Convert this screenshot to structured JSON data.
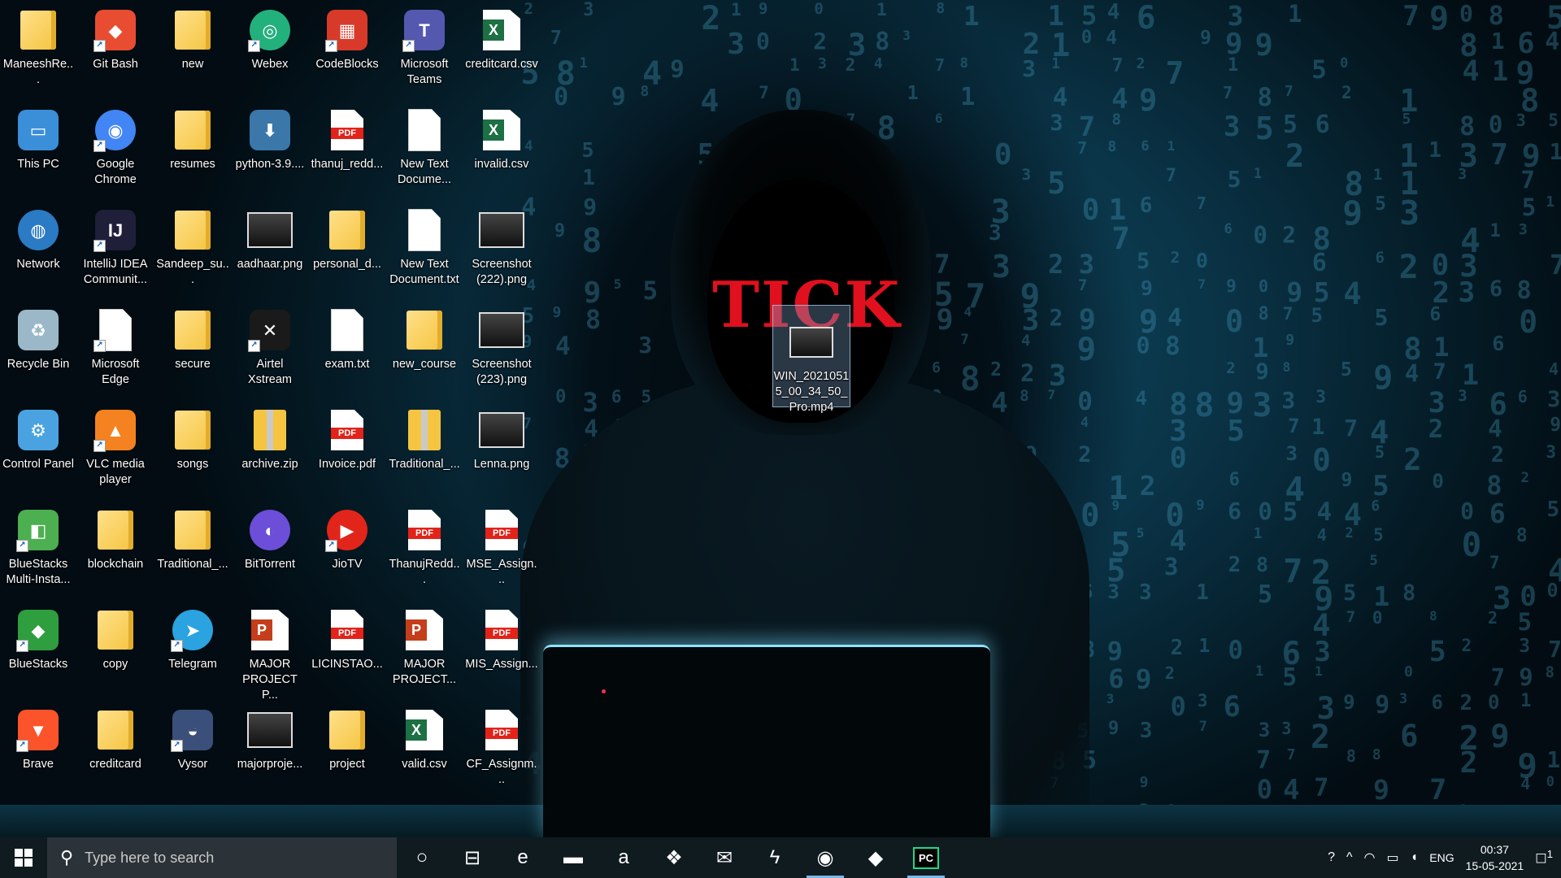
{
  "wallpaper": {
    "logo_text": "TICK"
  },
  "desktop_icons": [
    {
      "label": "ManeeshRe...",
      "icon": "user-folder-icon",
      "kind": "folder"
    },
    {
      "label": "This PC",
      "icon": "this-pc-icon",
      "kind": "app"
    },
    {
      "label": "Network",
      "icon": "network-icon",
      "kind": "app"
    },
    {
      "label": "Recycle Bin",
      "icon": "recycle-bin-icon",
      "kind": "app"
    },
    {
      "label": "Control Panel",
      "icon": "control-panel-icon",
      "kind": "app"
    },
    {
      "label": "BlueStacks Multi-Insta...",
      "icon": "bluestacks-multi-icon",
      "kind": "app"
    },
    {
      "label": "BlueStacks",
      "icon": "bluestacks-icon",
      "kind": "app"
    },
    {
      "label": "Brave",
      "icon": "brave-icon",
      "kind": "app"
    },
    {
      "label": "Git Bash",
      "icon": "git-bash-icon",
      "kind": "app"
    },
    {
      "label": "Google Chrome",
      "icon": "chrome-icon",
      "kind": "app"
    },
    {
      "label": "IntelliJ IDEA Communit...",
      "icon": "intellij-icon",
      "kind": "app"
    },
    {
      "label": "Microsoft Edge",
      "icon": "edge-shortcut-icon",
      "kind": "doc"
    },
    {
      "label": "VLC media player",
      "icon": "vlc-icon",
      "kind": "app"
    },
    {
      "label": "blockchain",
      "icon": "folder-icon",
      "kind": "folder"
    },
    {
      "label": "copy",
      "icon": "folder-icon",
      "kind": "folder"
    },
    {
      "label": "creditcard",
      "icon": "folder-icon",
      "kind": "folder"
    },
    {
      "label": "new",
      "icon": "folder-icon",
      "kind": "folder"
    },
    {
      "label": "resumes",
      "icon": "folder-icon",
      "kind": "folder"
    },
    {
      "label": "Sandeep_su...",
      "icon": "folder-icon",
      "kind": "folder"
    },
    {
      "label": "secure",
      "icon": "folder-icon",
      "kind": "folder"
    },
    {
      "label": "songs",
      "icon": "folder-icon",
      "kind": "folder"
    },
    {
      "label": "Traditional_...",
      "icon": "folder-icon",
      "kind": "folder"
    },
    {
      "label": "Telegram",
      "icon": "telegram-icon",
      "kind": "app"
    },
    {
      "label": "Vysor",
      "icon": "vysor-icon",
      "kind": "app"
    },
    {
      "label": "Webex",
      "icon": "webex-icon",
      "kind": "app"
    },
    {
      "label": "python-3.9....",
      "icon": "python-installer-icon",
      "kind": "app"
    },
    {
      "label": "aadhaar.png",
      "icon": "image-file-icon",
      "kind": "img"
    },
    {
      "label": "Airtel Xstream",
      "icon": "airtel-xstream-icon",
      "kind": "app"
    },
    {
      "label": "archive.zip",
      "icon": "zip-file-icon",
      "kind": "zip"
    },
    {
      "label": "BitTorrent",
      "icon": "bittorrent-icon",
      "kind": "app"
    },
    {
      "label": "MAJOR PROJECT P...",
      "icon": "powerpoint-file-icon",
      "kind": "ppt"
    },
    {
      "label": "majorproje...",
      "icon": "presentation-image-icon",
      "kind": "img"
    },
    {
      "label": "CodeBlocks",
      "icon": "codeblocks-icon",
      "kind": "app"
    },
    {
      "label": "thanuj_redd...",
      "icon": "pdf-file-icon",
      "kind": "pdf"
    },
    {
      "label": "personal_d...",
      "icon": "folder-icon",
      "kind": "folder"
    },
    {
      "label": "exam.txt",
      "icon": "text-file-icon",
      "kind": "doc"
    },
    {
      "label": "Invoice.pdf",
      "icon": "pdf-file-icon",
      "kind": "pdf"
    },
    {
      "label": "JioTV",
      "icon": "jiotv-icon",
      "kind": "app"
    },
    {
      "label": "LICINSTAO...",
      "icon": "pdf-file-icon",
      "kind": "pdf"
    },
    {
      "label": "project",
      "icon": "folder-icon",
      "kind": "folder"
    },
    {
      "label": "Microsoft Teams",
      "icon": "teams-icon",
      "kind": "app"
    },
    {
      "label": "New Text Docume...",
      "icon": "text-file-icon",
      "kind": "doc"
    },
    {
      "label": "New Text Document.txt",
      "icon": "text-file-icon",
      "kind": "doc"
    },
    {
      "label": "new_course",
      "icon": "folder-icon",
      "kind": "folder"
    },
    {
      "label": "Traditional_...",
      "icon": "zip-file-icon",
      "kind": "zip"
    },
    {
      "label": "ThanujRedd...",
      "icon": "pdf-file-icon",
      "kind": "pdf"
    },
    {
      "label": "MAJOR PROJECT...",
      "icon": "powerpoint-file-icon",
      "kind": "ppt"
    },
    {
      "label": "valid.csv",
      "icon": "excel-file-icon",
      "kind": "xls"
    },
    {
      "label": "creditcard.csv",
      "icon": "excel-file-icon",
      "kind": "xls"
    },
    {
      "label": "invalid.csv",
      "icon": "excel-file-icon",
      "kind": "xls"
    },
    {
      "label": "Screenshot (222).png",
      "icon": "image-file-icon",
      "kind": "img"
    },
    {
      "label": "Screenshot (223).png",
      "icon": "image-file-icon",
      "kind": "img"
    },
    {
      "label": "Lenna.png",
      "icon": "image-file-icon",
      "kind": "img"
    },
    {
      "label": "MSE_Assign...",
      "icon": "pdf-file-icon",
      "kind": "pdf"
    },
    {
      "label": "MIS_Assign...",
      "icon": "pdf-file-icon",
      "kind": "pdf"
    },
    {
      "label": "CF_Assignm...",
      "icon": "pdf-file-icon",
      "kind": "pdf"
    }
  ],
  "selected_file": {
    "label": "WIN_20210515_00_34_50_Pro.mp4",
    "icon": "video-file-icon"
  },
  "taskbar": {
    "search_placeholder": "Type here to search",
    "pinned": [
      {
        "name": "cortana-icon",
        "glyph": "○"
      },
      {
        "name": "task-view-icon",
        "glyph": "⊟"
      },
      {
        "name": "edge-icon",
        "glyph": "e"
      },
      {
        "name": "file-explorer-icon",
        "glyph": "▬"
      },
      {
        "name": "amazon-icon",
        "glyph": "a"
      },
      {
        "name": "dropbox-icon",
        "glyph": "❖"
      },
      {
        "name": "mail-icon",
        "glyph": "✉"
      },
      {
        "name": "power-automate-icon",
        "glyph": "ϟ"
      },
      {
        "name": "chrome-icon",
        "glyph": "◉"
      },
      {
        "name": "sticky-app-icon",
        "glyph": "◆"
      },
      {
        "name": "pycharm-icon",
        "glyph": "PC"
      }
    ],
    "tray": {
      "language": "ENG",
      "time": "00:37",
      "date": "15-05-2021",
      "notification_count": "1"
    }
  },
  "colors": {
    "taskbar_bg": "#101b20",
    "search_bg": "#2c3338",
    "logo_red": "#e0101e",
    "selection": "#78a0c8"
  }
}
